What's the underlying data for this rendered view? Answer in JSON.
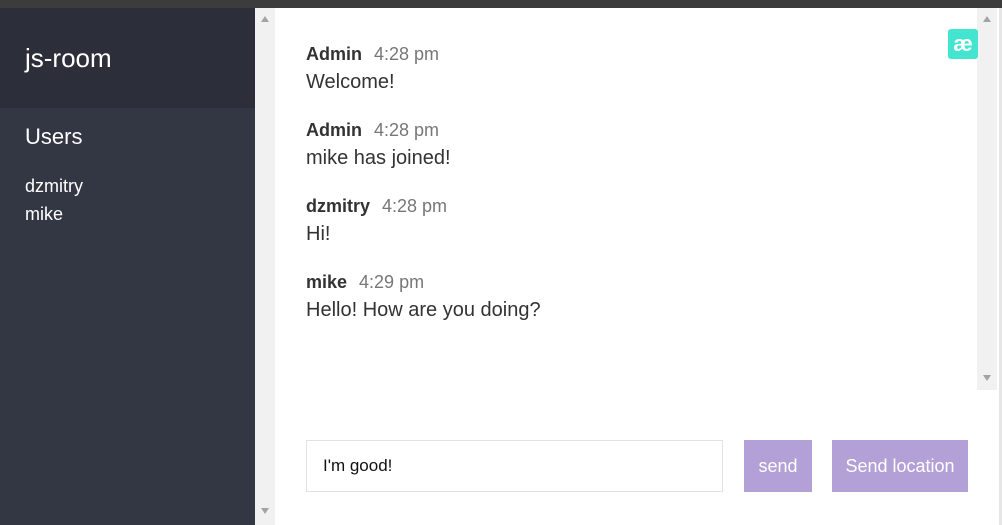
{
  "sidebar": {
    "room_title": "js-room",
    "users_heading": "Users",
    "users": [
      "dzmitry",
      "mike"
    ]
  },
  "messages": [
    {
      "name": "Admin",
      "time": "4:28 pm",
      "text": "Welcome!"
    },
    {
      "name": "Admin",
      "time": "4:28 pm",
      "text": "mike has joined!"
    },
    {
      "name": "dzmitry",
      "time": "4:28 pm",
      "text": "Hi!"
    },
    {
      "name": "mike",
      "time": "4:29 pm",
      "text": "Hello! How are you doing?"
    }
  ],
  "composer": {
    "input_value": "I'm good!",
    "send_label": "send",
    "location_label": "Send location"
  },
  "logo": {
    "glyph": "æ",
    "color": "#43e5d0"
  },
  "colors": {
    "sidebar_bg": "#333744",
    "sidebar_header_bg": "#2c2f3a",
    "button_bg": "#b3a0d6"
  }
}
